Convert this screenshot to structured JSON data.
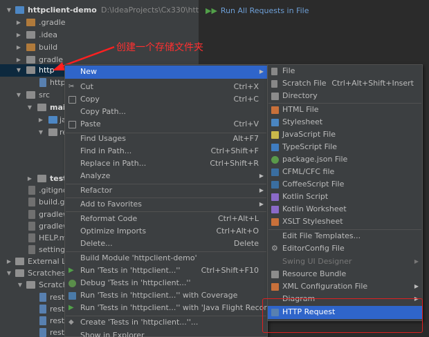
{
  "tree": {
    "rows": [
      {
        "label": "httpclient-demo",
        "path": "D:\\IdeaProjects\\Cx330\\httpclien"
      },
      {
        "label": ".gradle"
      },
      {
        "label": ".idea"
      },
      {
        "label": "build"
      },
      {
        "label": "gradle"
      },
      {
        "label": "http"
      },
      {
        "label": "httpC"
      },
      {
        "label": "src"
      },
      {
        "label": "mai"
      },
      {
        "label": "ja"
      },
      {
        "label": "re"
      },
      {
        "label": "test"
      },
      {
        "label": ".gitigno"
      },
      {
        "label": "build.gr"
      },
      {
        "label": "gradlew"
      },
      {
        "label": "gradlew"
      },
      {
        "label": "HELP.m"
      },
      {
        "label": "settings"
      },
      {
        "label": "External Lib"
      },
      {
        "label": "Scratches a"
      },
      {
        "label": "Scratche"
      },
      {
        "label": "rest-"
      },
      {
        "label": "rest-"
      },
      {
        "label": "rest-"
      },
      {
        "label": "rest-"
      },
      {
        "label": "rest-"
      }
    ]
  },
  "runbar": {
    "label": "Run All Requests in File"
  },
  "annotation": {
    "text": "创建一个存储文件夹"
  },
  "menu": {
    "items": [
      {
        "label": "New",
        "sub": true
      },
      {
        "label": "Cut",
        "shortcut": "Ctrl+X"
      },
      {
        "label": "Copy",
        "shortcut": "Ctrl+C"
      },
      {
        "label": "Copy Path..."
      },
      {
        "label": "Paste",
        "shortcut": "Ctrl+V"
      },
      {
        "label": "Find Usages",
        "shortcut": "Alt+F7"
      },
      {
        "label": "Find in Path...",
        "shortcut": "Ctrl+Shift+F"
      },
      {
        "label": "Replace in Path...",
        "shortcut": "Ctrl+Shift+R"
      },
      {
        "label": "Analyze",
        "sub": true
      },
      {
        "label": "Refactor",
        "sub": true
      },
      {
        "label": "Add to Favorites",
        "sub": true
      },
      {
        "label": "Reformat Code",
        "shortcut": "Ctrl+Alt+L"
      },
      {
        "label": "Optimize Imports",
        "shortcut": "Ctrl+Alt+O"
      },
      {
        "label": "Delete...",
        "shortcut": "Delete"
      },
      {
        "label": "Build Module 'httpclient-demo'"
      },
      {
        "label": "Run 'Tests in 'httpclient...''",
        "shortcut": "Ctrl+Shift+F10"
      },
      {
        "label": "Debug 'Tests in 'httpclient...''"
      },
      {
        "label": "Run 'Tests in 'httpclient...'' with Coverage"
      },
      {
        "label": "Run 'Tests in 'httpclient...'' with 'Java Flight Recorder'"
      },
      {
        "label": "Create 'Tests in 'httpclient...''..."
      },
      {
        "label": "Show in Explorer"
      }
    ]
  },
  "submenu": {
    "items": [
      {
        "label": "File"
      },
      {
        "label": "Scratch File",
        "shortcut": "Ctrl+Alt+Shift+Insert"
      },
      {
        "label": "Directory"
      },
      {
        "label": "HTML File"
      },
      {
        "label": "Stylesheet"
      },
      {
        "label": "JavaScript File"
      },
      {
        "label": "TypeScript File"
      },
      {
        "label": "package.json File"
      },
      {
        "label": "CFML/CFC file"
      },
      {
        "label": "CoffeeScript File"
      },
      {
        "label": "Kotlin Script"
      },
      {
        "label": "Kotlin Worksheet"
      },
      {
        "label": "XSLT Stylesheet"
      },
      {
        "label": "Edit File Templates..."
      },
      {
        "label": "EditorConfig File"
      },
      {
        "label": "Swing UI Designer",
        "sub": true
      },
      {
        "label": "Resource Bundle"
      },
      {
        "label": "XML Configuration File",
        "sub": true
      },
      {
        "label": "Diagram",
        "sub": true
      },
      {
        "label": "HTTP Request"
      }
    ]
  }
}
